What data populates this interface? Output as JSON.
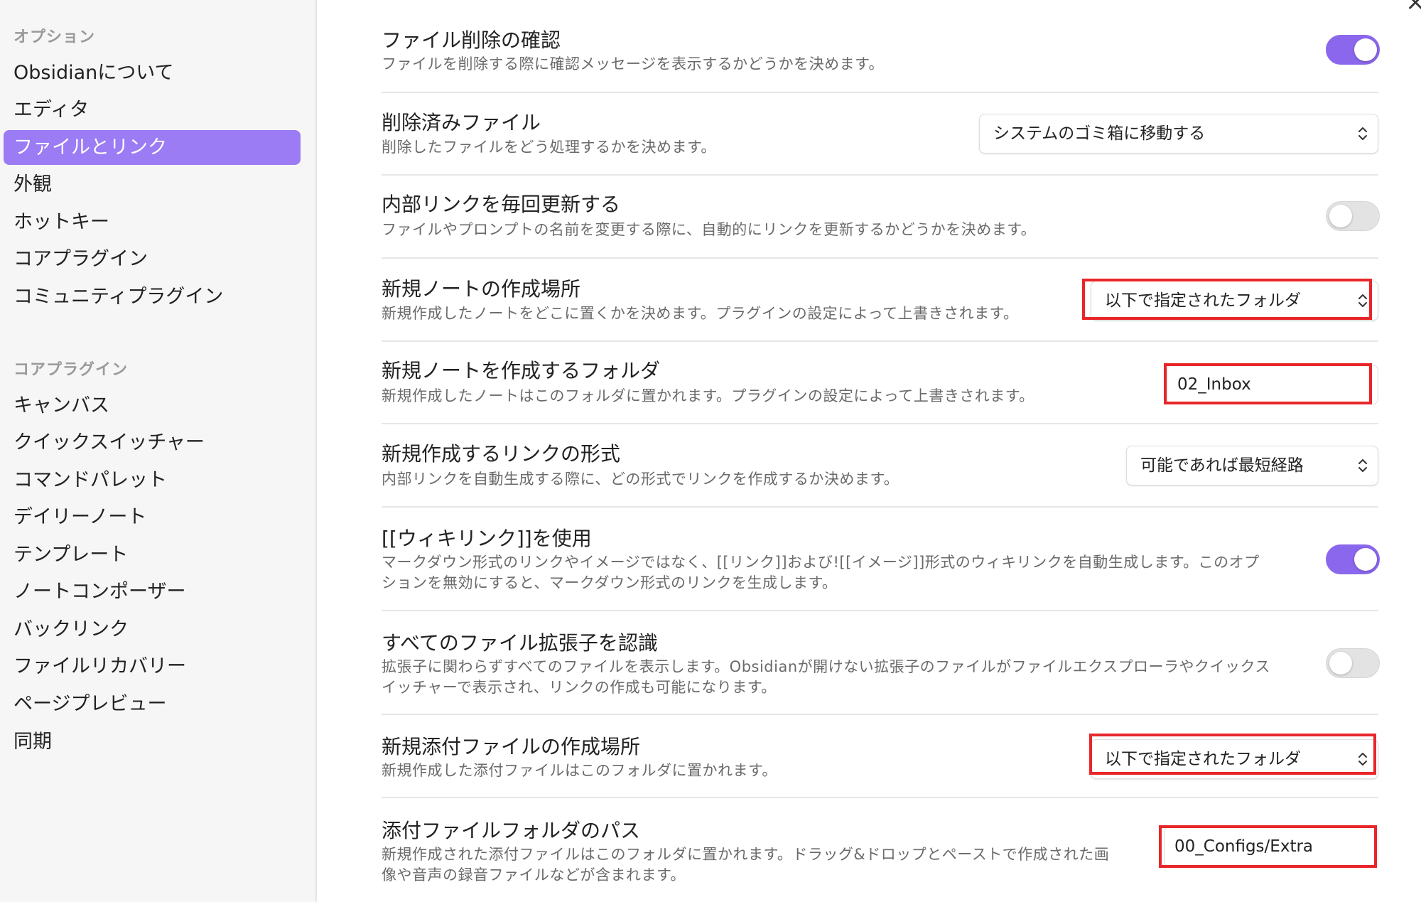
{
  "sidebar": {
    "options_heading": "オプション",
    "options": [
      "Obsidianについて",
      "エディタ",
      "ファイルとリンク",
      "外観",
      "ホットキー",
      "コアプラグイン",
      "コミュニティプラグイン"
    ],
    "active_index": 2,
    "core_heading": "コアプラグイン",
    "core": [
      "キャンバス",
      "クイックスイッチャー",
      "コマンドパレット",
      "デイリーノート",
      "テンプレート",
      "ノートコンポーザー",
      "バックリンク",
      "ファイルリカバリー",
      "ページプレビュー",
      "同期"
    ]
  },
  "close_icon": "×",
  "settings": {
    "confirm_delete": {
      "title": "ファイル削除の確認",
      "desc": "ファイルを削除する際に確認メッセージを表示するかどうかを決めます。",
      "enabled": true
    },
    "deleted_files": {
      "title": "削除済みファイル",
      "desc": "削除したファイルをどう処理するかを決めます。",
      "value": "システムのゴミ箱に移動する"
    },
    "update_links": {
      "title": "内部リンクを毎回更新する",
      "desc": "ファイルやプロンプトの名前を変更する際に、自動的にリンクを更新するかどうかを決めます。",
      "enabled": false
    },
    "new_note_location": {
      "title": "新規ノートの作成場所",
      "desc": "新規作成したノートをどこに置くかを決めます。プラグインの設定によって上書きされます。",
      "value": "以下で指定されたフォルダ"
    },
    "new_note_folder": {
      "title": "新規ノートを作成するフォルダ",
      "desc": "新規作成したノートはこのフォルダに置かれます。プラグインの設定によって上書きされます。",
      "value": "02_Inbox"
    },
    "link_format": {
      "title": "新規作成するリンクの形式",
      "desc": "内部リンクを自動生成する際に、どの形式でリンクを作成するか決めます。",
      "value": "可能であれば最短経路"
    },
    "wikilinks": {
      "title": "[[ウィキリンク]]を使用",
      "desc_line1": "マークダウン形式のリンクやイメージではなく、[[リンク]]および![[イメージ]]形式のウィキリンクを自動生成します。このオプ",
      "desc_line2": "ションを無効にすると、マークダウン形式のリンクを生成します。",
      "enabled": true
    },
    "all_extensions": {
      "title": "すべてのファイル拡張子を認識",
      "desc_line1": "拡張子に関わらずすべてのファイルを表示します。Obsidianが開けない拡張子のファイルがファイルエクスプローラやクイックス",
      "desc_line2": "イッチャーで表示され、リンクの作成も可能になります。",
      "enabled": false
    },
    "attachment_location": {
      "title": "新規添付ファイルの作成場所",
      "desc": "新規作成した添付ファイルはこのフォルダに置かれます。",
      "value": "以下で指定されたフォルダ"
    },
    "attachment_path": {
      "title": "添付ファイルフォルダのパス",
      "desc_line1": "新規作成された添付ファイルはこのフォルダに置かれます。ドラッグ&ドロップとペーストで作成された画",
      "desc_line2": "像や音声の録音ファイルなどが含まれます。",
      "value": "00_Configs/Extra"
    }
  },
  "colors": {
    "accent": "#8a67ec",
    "sidebar_active": "#9b7cf4",
    "highlight": "#e8262a"
  },
  "icons": {
    "select_chevron": "chevron-up-down-icon"
  }
}
